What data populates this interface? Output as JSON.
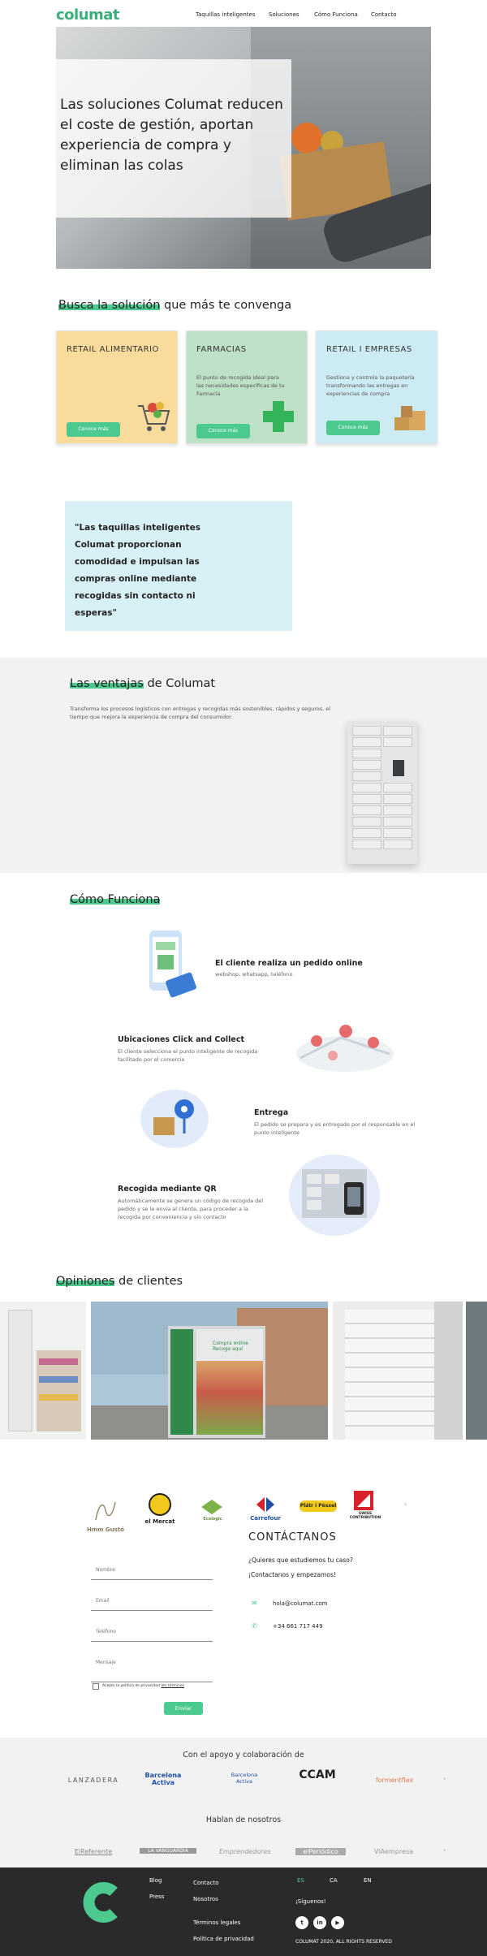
{
  "header": {
    "logo": "columat",
    "nav": [
      "Taquillas inteligentes",
      "Soluciones",
      "Cómo Funciona",
      "Contacto"
    ]
  },
  "hero": {
    "title": "Las soluciones Columat reducen el coste de gestión, aportan experiencia de compra y eliminan las colas"
  },
  "solutions": {
    "title_highlight": "Busca la solución",
    "title_rest": " que más te convenga",
    "cards": [
      {
        "title": "RETAIL ALIMENTARIO",
        "desc": "",
        "button": "Conoce más",
        "bg": "#f9dc9c",
        "icon": "shopping-cart-icon"
      },
      {
        "title": "FARMACIAS",
        "desc": "El punto de recogida ideal para las necesidades específicas de tu Farmacia",
        "button": "Conoce más",
        "bg": "#bde0c7",
        "icon": "pharmacy-cross-icon"
      },
      {
        "title": "RETAIL I EMPRESAS",
        "desc": "Gestiona y controla la paquetería transformando las entregas en experiencias de compra",
        "button": "Conoce más",
        "bg": "#cdebf3",
        "icon": "parcels-icon"
      }
    ]
  },
  "quote": {
    "text": "\"Las taquillas inteligentes Columat proporcionan comodidad e impulsan las compras online mediante recogidas sin contacto ni esperas\""
  },
  "advantages": {
    "title_highlight": "Las ventajas",
    "title_rest": " de Columat",
    "desc": "Transforma los procesos logísticos con entregas y recogidas más sostenibles, rápidos y seguros, el tiempo que mejora la experiencia de compra del consumidor."
  },
  "how": {
    "title": "Cómo Funciona",
    "steps": [
      {
        "title": "El cliente realiza un pedido online",
        "desc": "webshop, whatsapp, teléfono"
      },
      {
        "title": "Ubicaciones Click and Collect",
        "desc": "El cliente selecciona el punto inteligente de recogida facilitado por el comercio"
      },
      {
        "title": "Entrega",
        "desc": "El pedido se prepara y es entregado por el responsable en el punto inteligente"
      },
      {
        "title": "Recogida mediante QR",
        "desc": "Automáticamente se genera un código de recogida del pedido y se le envía al cliente, para proceder a la recogida por conveniencia y sin contacto"
      }
    ]
  },
  "reviews": {
    "title_highlight": "Opiniones",
    "title_rest": " de clientes",
    "locker_screen_text": "Compra online Recoge aquí"
  },
  "brands": [
    "Hmm Gustó",
    "el Mercat",
    "Ecologic",
    "Carrefour",
    "Plátr i Pèsxel",
    "SWISS CONTRIBUTION"
  ],
  "contact": {
    "fields": [
      "Nombre",
      "Email",
      "Teléfono",
      "Mensaje"
    ],
    "privacy": "Acepto la política de privacidad",
    "privacy_link": "Ver términos",
    "send": "Enviar",
    "title": "CONTÁCTANOS",
    "sub1": "¿Quieres que estudiemos tu caso?",
    "sub2": "¡Contactanos y empezamos!",
    "email": "hola@columat.com",
    "phone": "+34 661 717 449"
  },
  "support": {
    "title": "Con el apoyo y colaboración de",
    "logos": [
      "LANZADERA",
      "Barcelona Activa",
      "Barcelona Activa",
      "CCAM",
      "formentflex"
    ],
    "press_title": "Hablan de nosotros",
    "press": [
      "ElReferente",
      "LA VANGUARDIA",
      "Emprendedores",
      "elPeriódico",
      "VIAempresa"
    ]
  },
  "footer": {
    "col1": [
      "Blog",
      "Press"
    ],
    "col2": [
      "Contacto",
      "Nosotros",
      "Términos legales",
      "Política de privacidad"
    ],
    "langs": [
      "ES",
      "CA",
      "EN"
    ],
    "follow": "¡Síguenos!",
    "copyright": "COLUMAT 2020, ALL RIGHTS RESERVED"
  },
  "colors": {
    "accent": "#4bc98f",
    "logo": "#3cae7c",
    "footer_bg": "#2a2a2a",
    "light_bg": "#f2f2f2"
  }
}
